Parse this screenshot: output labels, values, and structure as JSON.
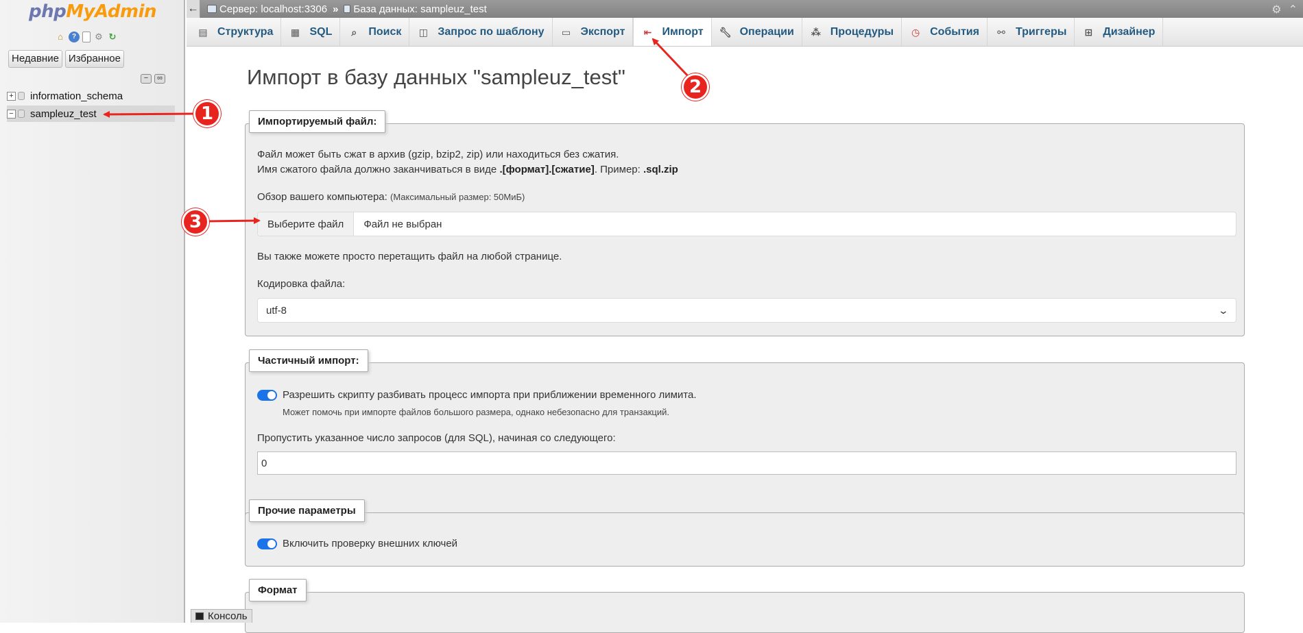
{
  "nav": {
    "logo_php": "php",
    "logo_myadmin": "MyAdmin",
    "icons": [
      "home-icon",
      "help-icon",
      "docs-icon",
      "settings-icon",
      "reload-icon"
    ],
    "recent_label": "Недавние",
    "favorites_label": "Избранное",
    "tree": [
      {
        "label": "information_schema",
        "expanded": false,
        "selected": false
      },
      {
        "label": "sampleuz_test",
        "expanded": true,
        "selected": true
      }
    ]
  },
  "topbar": {
    "server": "Сервер: localhost:3306",
    "separator": "»",
    "database": "База данных: sampleuz_test"
  },
  "tabs": [
    {
      "label": "Структура",
      "icon": "structure-icon"
    },
    {
      "label": "SQL",
      "icon": "sql-icon"
    },
    {
      "label": "Поиск",
      "icon": "search-icon"
    },
    {
      "label": "Запрос по шаблону",
      "icon": "query-icon"
    },
    {
      "label": "Экспорт",
      "icon": "export-icon"
    },
    {
      "label": "Импорт",
      "icon": "import-icon",
      "active": true
    },
    {
      "label": "Операции",
      "icon": "wrench-icon"
    },
    {
      "label": "Процедуры",
      "icon": "routines-icon"
    },
    {
      "label": "События",
      "icon": "clock-icon"
    },
    {
      "label": "Триггеры",
      "icon": "triggers-icon"
    },
    {
      "label": "Дизайнер",
      "icon": "designer-icon"
    }
  ],
  "main": {
    "title": "Импорт в базу данных \"sampleuz_test\"",
    "file_section": {
      "legend": "Импортируемый файл:",
      "line1": "Файл может быть сжат в архив (gzip, bzip2, zip) или находиться без сжатия.",
      "line2_prefix": "Имя сжатого файла должно заканчиваться в виде ",
      "line2_format": ".[формат].[сжатие]",
      "line2_mid": ". Пример: ",
      "line2_example": ".sql.zip",
      "browse_label": "Обзор вашего компьютера:",
      "max_size": "(Максимальный размер: 50МиБ)",
      "choose_file_button": "Выберите файл",
      "no_file_text": "Файл не выбран",
      "drag_hint": "Вы также можете просто перетащить файл на любой странице.",
      "charset_label": "Кодировка файла:",
      "charset_value": "utf-8"
    },
    "partial_section": {
      "legend": "Частичный импорт:",
      "allow_interrupt_label": "Разрешить скрипту разбивать процесс импорта при приближении временного лимита.",
      "allow_interrupt_on": true,
      "allow_interrupt_hint": "Может помочь при импорте файлов большого размера, однако небезопасно для транзакций.",
      "skip_label": "Пропустить указанное число запросов (для SQL), начиная со следующего:",
      "skip_value": "0"
    },
    "other_section": {
      "legend": "Прочие параметры",
      "fk_checks_label": "Включить проверку внешних ключей",
      "fk_checks_on": true
    },
    "format_section": {
      "legend": "Формат"
    }
  },
  "console": {
    "label": "Консоль"
  },
  "annotations": [
    {
      "number": "1",
      "target": "sampleuz_test"
    },
    {
      "number": "2",
      "target": "Импорт"
    },
    {
      "number": "3",
      "target": "Выберите файл"
    }
  ],
  "colors": {
    "annotation": "#e8241f",
    "tab_text": "#235a81",
    "toggle_on": "#1a73e8"
  }
}
